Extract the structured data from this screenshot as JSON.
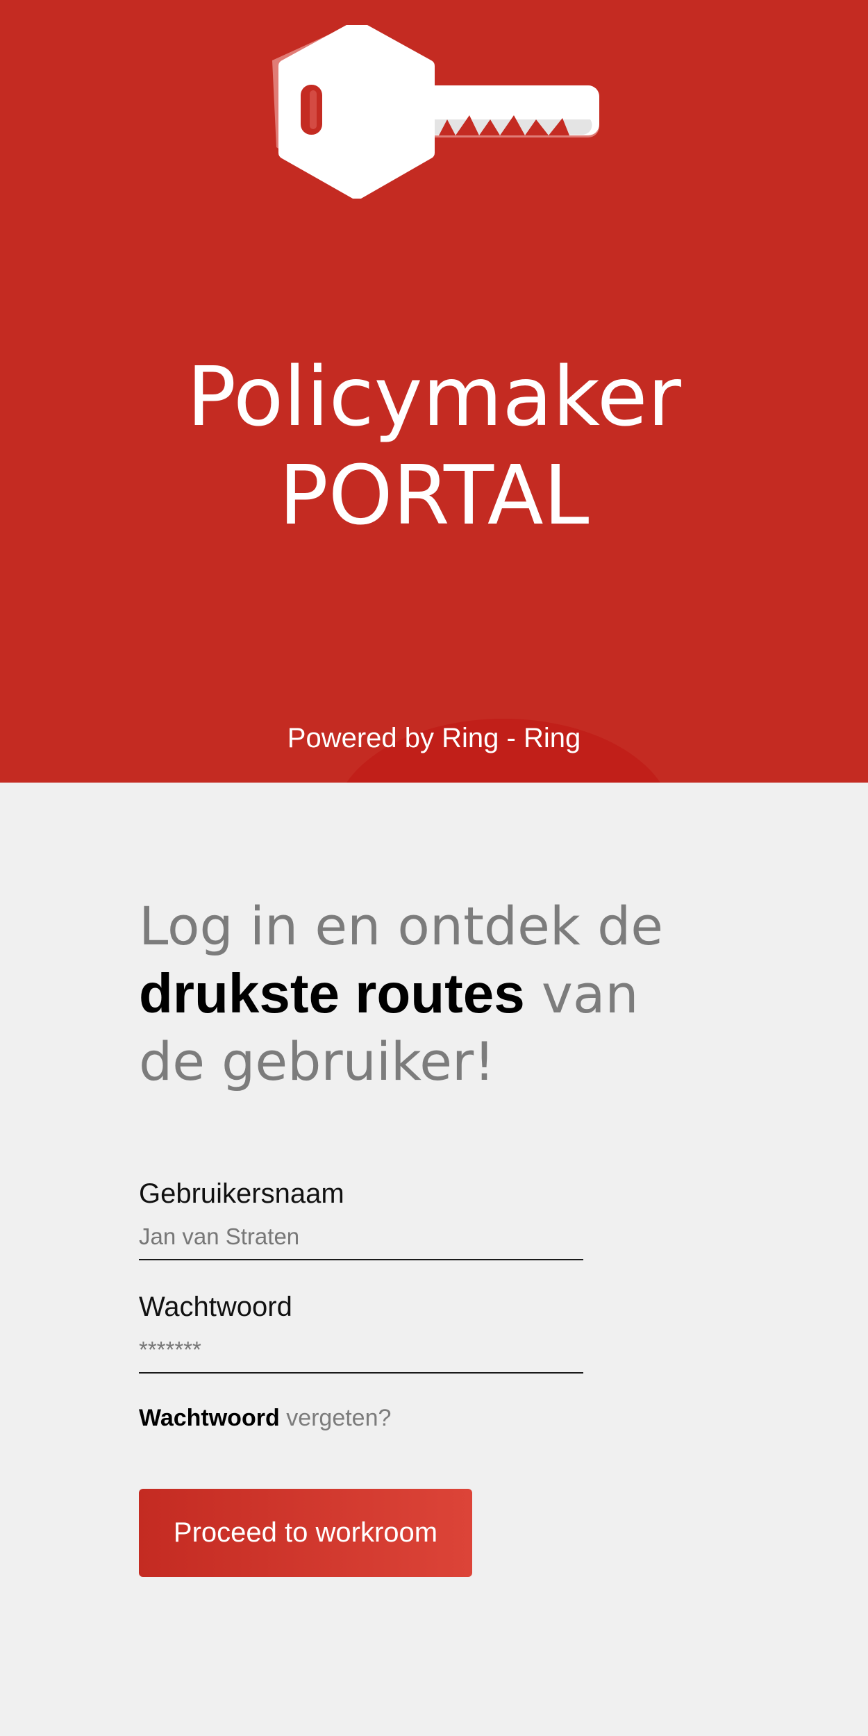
{
  "brand": {
    "title_line1": "Policymaker",
    "title_line2": "PORTAL",
    "powered_by": "Powered by Ring - Ring",
    "logo_icon": "key-icon"
  },
  "login": {
    "headline_start": "Log in en ontdek de",
    "headline_bold": "drukste routes",
    "headline_mid": "van",
    "headline_end": "de gebruiker!",
    "username": {
      "label": "Gebruikersnaam",
      "placeholder": "Jan van Straten"
    },
    "password": {
      "label": "Wachtwoord",
      "placeholder": "*******"
    },
    "forgot_bold": "Wachtwoord",
    "forgot_rest": "vergeten?",
    "submit_label": "Proceed to workroom"
  },
  "colors": {
    "brand_red": "#c42b22",
    "button_gradient_end": "#dc4438",
    "panel_background": "#f0f0f0",
    "headline_grey": "#7c7c7c"
  }
}
